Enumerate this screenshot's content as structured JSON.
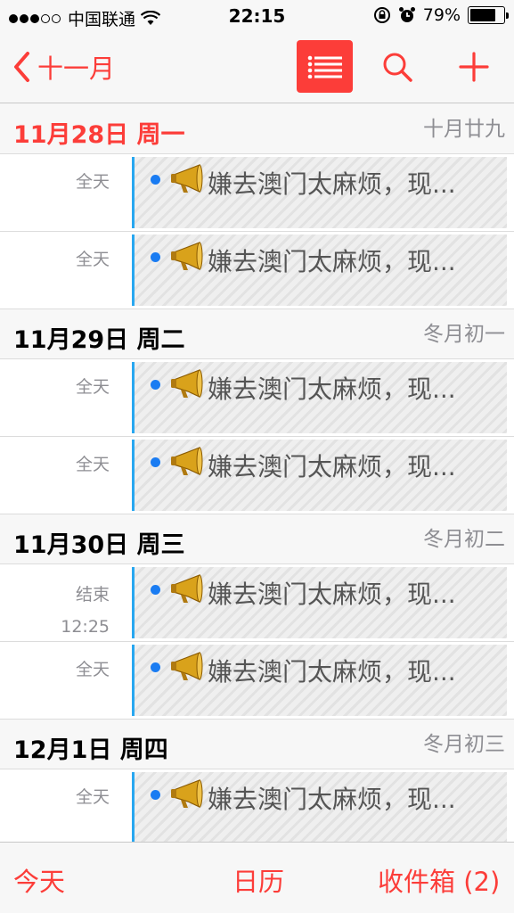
{
  "status_bar": {
    "carrier": "中国联通",
    "time": "22:15",
    "battery": "79%",
    "battery_level": 0.79,
    "icons": [
      "wifi-icon",
      "rotation-lock-icon",
      "alarm-icon",
      "battery-icon"
    ]
  },
  "nav": {
    "back_label": "十一月",
    "icons": [
      "chevron-left-icon",
      "list-icon",
      "search-icon",
      "plus-icon"
    ],
    "accent_color": "#fc3d39"
  },
  "days": [
    {
      "title": "11月28日 周一",
      "lunar": "十月廿九",
      "is_today": true,
      "events": [
        {
          "time": "全天",
          "title": "嫌去澳门太麻烦，现..."
        },
        {
          "time": "全天",
          "title": "嫌去澳门太麻烦，现..."
        }
      ]
    },
    {
      "title": "11月29日 周二",
      "lunar": "冬月初一",
      "is_today": false,
      "events": [
        {
          "time": "全天",
          "title": "嫌去澳门太麻烦，现..."
        },
        {
          "time": "全天",
          "title": "嫌去澳门太麻烦，现..."
        }
      ]
    },
    {
      "title": "11月30日 周三",
      "lunar": "冬月初二",
      "is_today": false,
      "events": [
        {
          "time": "结束",
          "time2": "12:25",
          "title": "嫌去澳门太麻烦，现..."
        },
        {
          "time": "全天",
          "title": "嫌去澳门太麻烦，现..."
        }
      ]
    },
    {
      "title": "12月1日 周四",
      "lunar": "冬月初三",
      "is_today": false,
      "events": [
        {
          "time": "全天",
          "title": "嫌去澳门太麻烦，现..."
        }
      ]
    }
  ],
  "event_icon": "megaphone-icon",
  "event_colors": {
    "bar": "#28a7f0",
    "dot": "#1a7cf2"
  },
  "tabs": {
    "today": "今天",
    "calendars": "日历",
    "inbox": "收件箱 (2)"
  }
}
